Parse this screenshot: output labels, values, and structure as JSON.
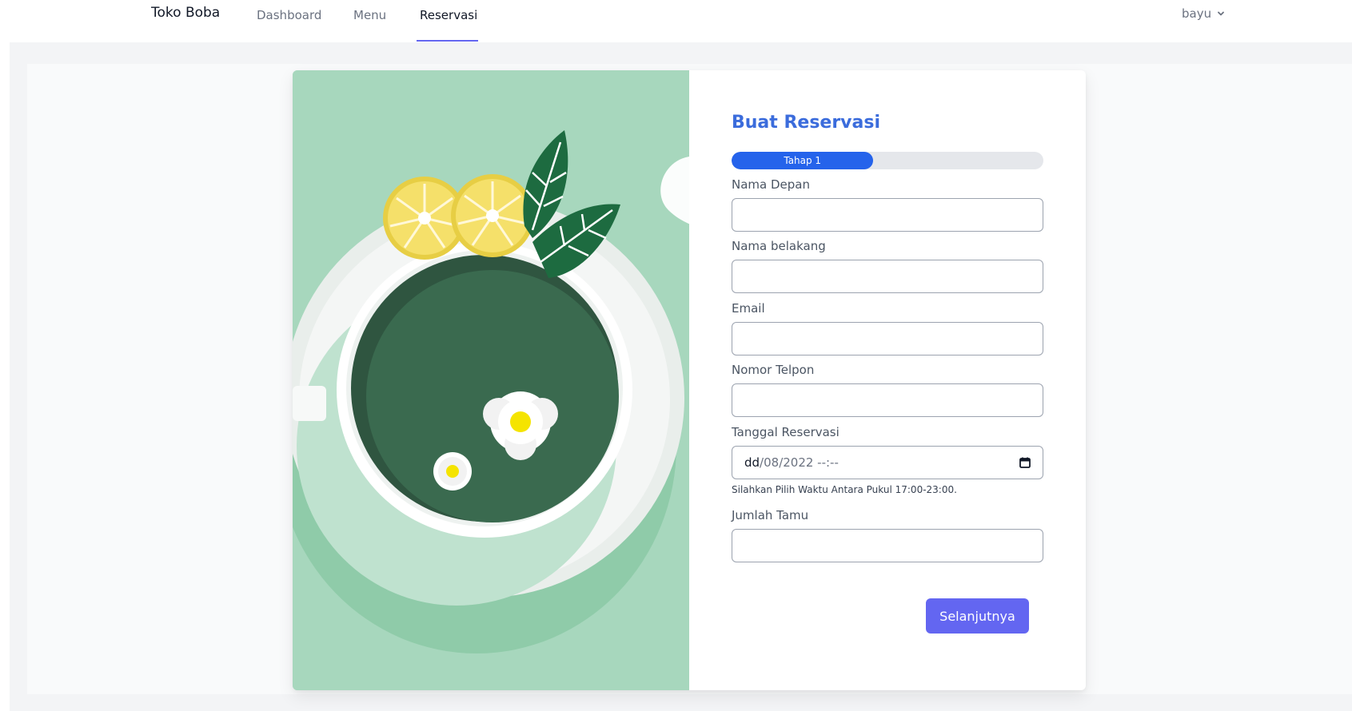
{
  "nav": {
    "brand": "Toko Boba",
    "links": [
      {
        "label": "Dashboard",
        "active": false
      },
      {
        "label": "Menu",
        "active": false
      },
      {
        "label": "Reservasi",
        "active": true
      }
    ],
    "user": "bayu",
    "accent_color": "#6366f1"
  },
  "form": {
    "title": "Buat Reservasi",
    "progress": {
      "label": "Tahap 1",
      "fraction": 0.455
    },
    "fields": {
      "first_name": {
        "label": "Nama Depan",
        "value": ""
      },
      "last_name": {
        "label": "Nama belakang",
        "value": ""
      },
      "email": {
        "label": "Email",
        "value": ""
      },
      "phone": {
        "label": "Nomor Telpon",
        "value": ""
      },
      "date": {
        "label": "Tanggal Reservasi",
        "day_placeholder": "dd",
        "value_rest": "/08/2022 --:--"
      },
      "guests": {
        "label": "Jumlah Tamu",
        "value": ""
      }
    },
    "help_text": "Silahkan Pilih Waktu Antara Pukul 17:00-23:00.",
    "next_label": "Selanjutnya"
  },
  "colors": {
    "title": "#3b6cdc",
    "progress": "#2563eb",
    "button": "#6366f1",
    "illustration_bg": "#a7d7bd"
  },
  "icons": [
    "chevron-down-icon",
    "calendar-icon"
  ]
}
